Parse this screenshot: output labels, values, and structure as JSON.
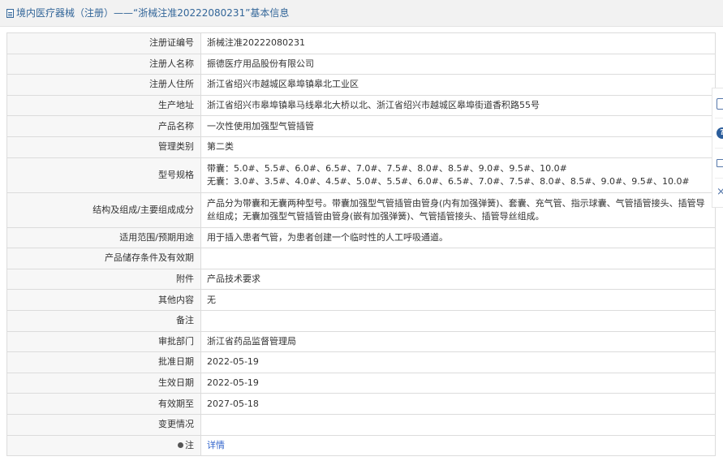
{
  "header": {
    "icon": "document-icon",
    "title": "境内医疗器械（注册）——“浙械注准20222080231”基本信息"
  },
  "rows": [
    {
      "label": "注册证编号",
      "value": "浙械注准20222080231"
    },
    {
      "label": "注册人名称",
      "value": "振德医疗用品股份有限公司"
    },
    {
      "label": "注册人住所",
      "value": "浙江省绍兴市越城区皋埠镇皋北工业区"
    },
    {
      "label": "生产地址",
      "value": "浙江省绍兴市皋埠镇皋马线皋北大桥以北、浙江省绍兴市越城区皋埠街道香积路55号"
    },
    {
      "label": "产品名称",
      "value": "一次性使用加强型气管插管"
    },
    {
      "label": "管理类别",
      "value": "第二类"
    },
    {
      "label": "型号规格",
      "value_lines": [
        "带囊：5.0#、5.5#、6.0#、6.5#、7.0#、7.5#、8.0#、8.5#、9.0#、9.5#、10.0#",
        "无囊：3.0#、3.5#、4.0#、4.5#、5.0#、5.5#、6.0#、6.5#、7.0#、7.5#、8.0#、8.5#、9.0#、9.5#、10.0#"
      ]
    },
    {
      "label": "结构及组成/主要组成成分",
      "value": "产品分为带囊和无囊两种型号。带囊加强型气管插管由管身(内有加强弹簧)、套囊、充气管、指示球囊、气管插管接头、插管导丝组成；无囊加强型气管插管由管身(嵌有加强弹簧)、气管插管接头、插管导丝组成。"
    },
    {
      "label": "适用范围/预期用途",
      "value": "用于插入患者气管，为患者创建一个临时性的人工呼吸通道。"
    },
    {
      "label": "产品储存条件及有效期",
      "value": ""
    },
    {
      "label": "附件",
      "value": "产品技术要求"
    },
    {
      "label": "其他内容",
      "value": "无"
    },
    {
      "label": "备注",
      "value": ""
    },
    {
      "label": "审批部门",
      "value": "浙江省药品监督管理局"
    },
    {
      "label": "批准日期",
      "value": "2022-05-19"
    },
    {
      "label": "生效日期",
      "value": "2022-05-19"
    },
    {
      "label": "有效期至",
      "value": "2027-05-18"
    },
    {
      "label": "变更情况",
      "value": ""
    },
    {
      "label": "注",
      "label_icon": "bulb-icon",
      "value": "详情"
    }
  ],
  "side_toolbar": {
    "icons": [
      "edit-icon",
      "help-icon",
      "print-icon",
      "close-icon"
    ],
    "help_glyph": "?",
    "close_glyph": "×"
  }
}
